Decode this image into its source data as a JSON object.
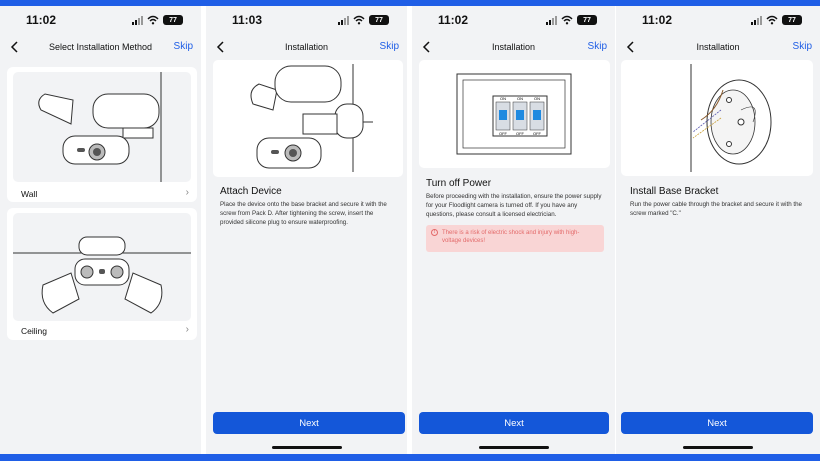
{
  "colors": {
    "accent": "#1f5ee6",
    "button": "#1457d9",
    "warning_bg": "#f9d5d5",
    "warning_text": "#e36a6a"
  },
  "screens": [
    {
      "status": {
        "time": "11:02",
        "battery": "77"
      },
      "nav": {
        "title": "Select Installation Method",
        "skip": "Skip"
      },
      "options": [
        {
          "label": "Wall",
          "icon": "chevron-right-icon"
        },
        {
          "label": "Ceiling",
          "icon": "chevron-right-icon"
        }
      ]
    },
    {
      "status": {
        "time": "11:03",
        "battery": "77"
      },
      "nav": {
        "title": "Installation",
        "skip": "Skip"
      },
      "heading": "Attach Device",
      "body": "Place the device onto the base bracket and secure it with the screw from Pack D. After tightening the screw, insert the provided silicone plug to ensure waterproofing.",
      "button": "Next"
    },
    {
      "status": {
        "time": "11:02",
        "battery": "77"
      },
      "nav": {
        "title": "Installation",
        "skip": "Skip"
      },
      "breaker_labels": {
        "on": "ON",
        "off": "OFF"
      },
      "heading": "Turn off Power",
      "body": "Before proceeding with the installation, ensure the power supply for your Floodlight camera is turned off. If you have any questions, please consult a licensed electrician.",
      "warning": "There is a risk of electric shock and injury with high-voltage devices!",
      "button": "Next"
    },
    {
      "status": {
        "time": "11:02",
        "battery": "77"
      },
      "nav": {
        "title": "Installation",
        "skip": "Skip"
      },
      "heading": "Install Base Bracket",
      "body": "Run the power cable  through the bracket and secure it with the screw marked \"C.\"",
      "button": "Next"
    }
  ]
}
